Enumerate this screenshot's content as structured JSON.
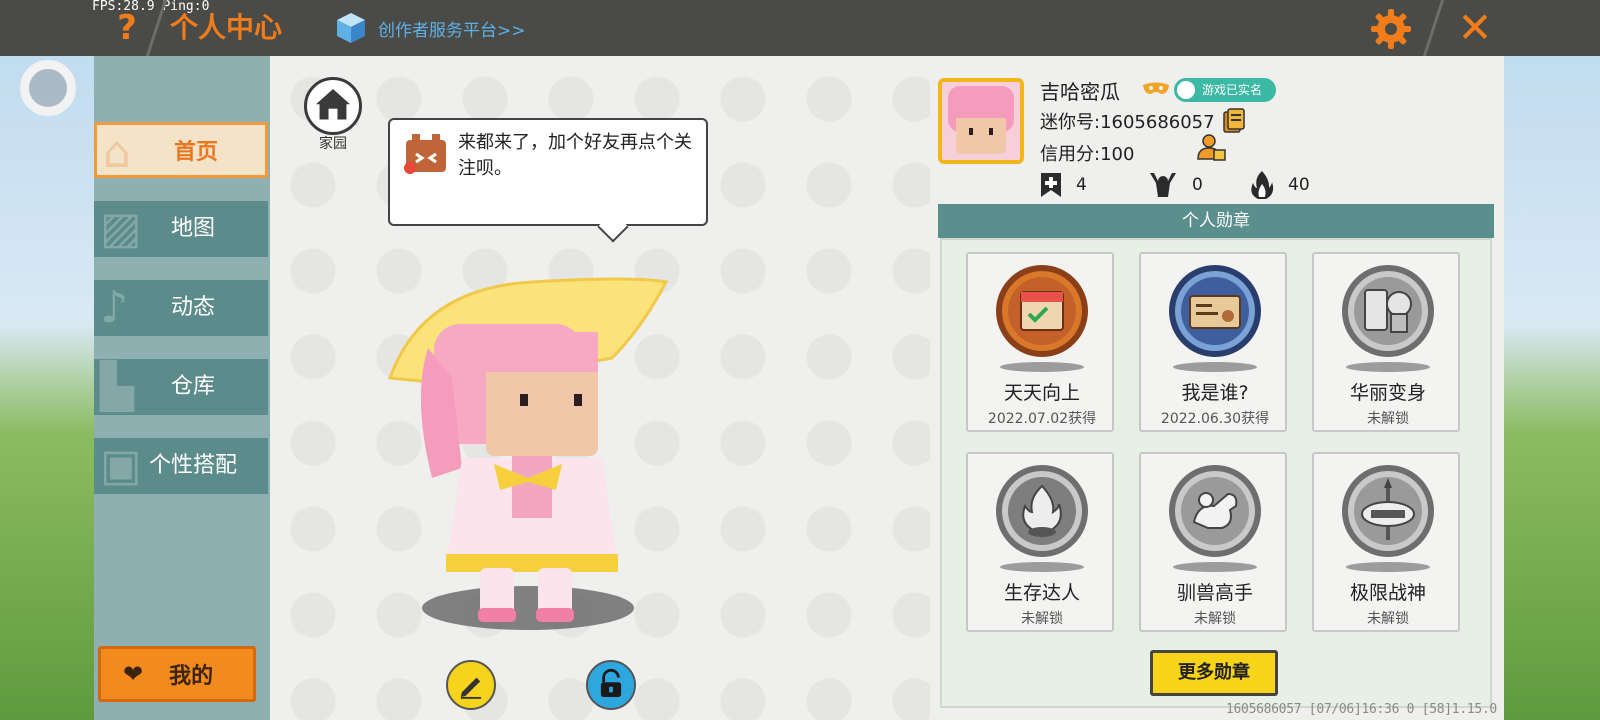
{
  "hud": {
    "fps": "FPS:28.9  Ping:0"
  },
  "header": {
    "title": "个人中心",
    "creator_link": "创作者服务平台>>",
    "help_symbol": "?",
    "close_symbol": "✕",
    "accent": "#f07c1c"
  },
  "sidebar": {
    "items": [
      {
        "label": "首页",
        "icon": "house-icon",
        "active": true
      },
      {
        "label": "地图",
        "icon": "map-icon",
        "active": false
      },
      {
        "label": "动态",
        "icon": "bell-icon",
        "active": false
      },
      {
        "label": "仓库",
        "icon": "warehouse-icon",
        "active": false
      },
      {
        "label": "个性搭配",
        "icon": "outfit-icon",
        "active": false
      }
    ],
    "mine_label": "我的"
  },
  "home": {
    "label": "家园"
  },
  "speech": {
    "text": "来都来了，加个好友再点个关注呗。"
  },
  "profile": {
    "name": "吉哈密瓜",
    "verified": "游戏已实名",
    "mini_id": "迷你号:1605686057",
    "credit": "信用分:100",
    "stats": [
      {
        "icon": "bookmark-plus-icon",
        "value": "4"
      },
      {
        "icon": "fans-icon",
        "value": "0"
      },
      {
        "icon": "flame-icon",
        "value": "40"
      }
    ]
  },
  "badges": {
    "header": "个人勋章",
    "items": [
      {
        "name": "天天向上",
        "status": "2022.07.02获得",
        "unlocked": true
      },
      {
        "name": "我是谁?",
        "status": "2022.06.30获得",
        "unlocked": true
      },
      {
        "name": "华丽变身",
        "status": "未解锁",
        "unlocked": false
      },
      {
        "name": "生存达人",
        "status": "未解锁",
        "unlocked": false
      },
      {
        "name": "驯兽高手",
        "status": "未解锁",
        "unlocked": false
      },
      {
        "name": "极限战神",
        "status": "未解锁",
        "unlocked": false
      }
    ],
    "more_label": "更多勋章"
  },
  "footer": {
    "text": "1605686057  [07/06]16:36 0  [58]1.15.0"
  }
}
